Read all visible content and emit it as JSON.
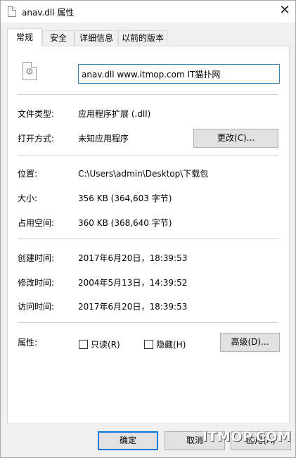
{
  "window": {
    "title": "anav.dll 属性",
    "close_glyph": "✕"
  },
  "tabs": [
    {
      "label": "常规",
      "active": true
    },
    {
      "label": "安全",
      "active": false
    },
    {
      "label": "详细信息",
      "active": false
    },
    {
      "label": "以前的版本",
      "active": false
    }
  ],
  "general": {
    "file_name": "anav.dll www.itmop.com IT猫扑网",
    "file_type_label": "文件类型:",
    "file_type_value": "应用程序扩展 (.dll)",
    "opens_with_label": "打开方式:",
    "opens_with_value": "未知应用程序",
    "change_button": "更改(C)...",
    "location_label": "位置:",
    "location_value": "C:\\Users\\admin\\Desktop\\下载包",
    "size_label": "大小:",
    "size_value": "356 KB (364,603 字节)",
    "size_on_disk_label": "占用空间:",
    "size_on_disk_value": "360 KB (368,640 字节)",
    "created_label": "创建时间:",
    "created_value": "2017年6月20日，18:39:53",
    "modified_label": "修改时间:",
    "modified_value": "2004年5月13日，14:39:52",
    "accessed_label": "访问时间:",
    "accessed_value": "2017年6月20日，18:39:53",
    "attributes_label": "属性:",
    "readonly_label": "只读(R)",
    "readonly_checked": false,
    "hidden_label": "隐藏(H)",
    "hidden_checked": false,
    "advanced_button": "高级(D)..."
  },
  "footer": {
    "ok_button": "确定",
    "cancel_button": "取消",
    "apply_button": "应用(A)"
  },
  "watermark": "ITMOP.COM",
  "colors": {
    "focus_blue": "#0078d7",
    "input_border": "#3c7fb1"
  }
}
